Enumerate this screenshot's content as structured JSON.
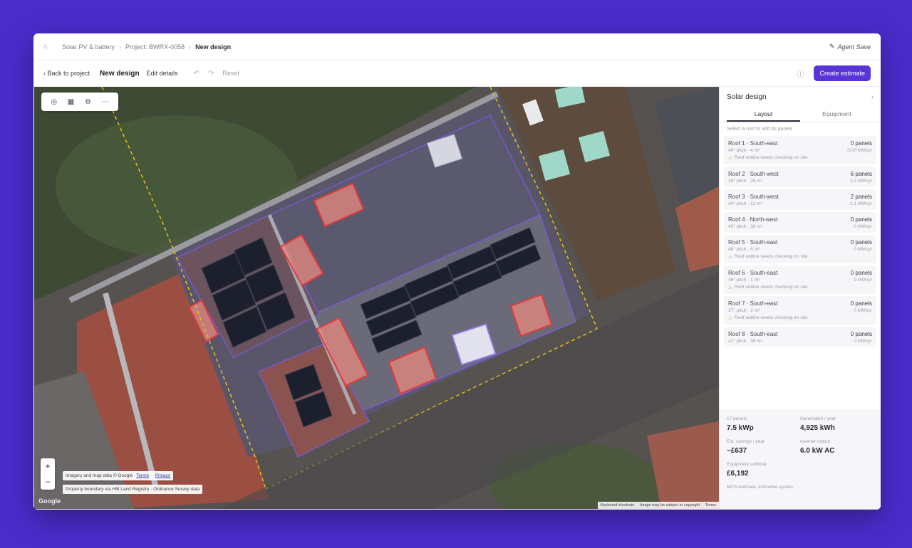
{
  "breadcrumb": {
    "items": [
      "Solar PV & battery",
      "Project: BWRX-0058"
    ],
    "current": "New design",
    "agent_save": "Agent Save"
  },
  "toolbar": {
    "back_label": "Back to project",
    "design_title": "New design",
    "edit_details": "Edit details",
    "reset": "Reset",
    "create_estimate": "Create estimate"
  },
  "map": {
    "attribution": "Imagery and map data © Google",
    "terms": "Terms",
    "privacy": "Privacy",
    "boundary_note": "Property boundary via HM Land Registry · Ordnance Survey data",
    "google": "Google",
    "footer": [
      "Keyboard shortcuts",
      "Image may be subject to copyright",
      "Terms"
    ]
  },
  "panel": {
    "title": "Solar design",
    "tabs": [
      "Layout",
      "Equipment"
    ],
    "hint": "Select a roof to add its panels",
    "roofs": [
      {
        "name": "Roof 1 · South-east",
        "panels": "0 panels",
        "meta": "40° pitch · 4 m²",
        "extra": "0.00 kWh/yr",
        "warn": "Roof outline needs checking on site"
      },
      {
        "name": "Roof 2 · South-west",
        "panels": "6 panels",
        "meta": "39° pitch · 26 m²",
        "extra": "3.2 kWh/yr",
        "warn": ""
      },
      {
        "name": "Roof 3 · South-west",
        "panels": "2 panels",
        "meta": "44° pitch · 13 m²",
        "extra": "1.1 kWh/yr",
        "warn": ""
      },
      {
        "name": "Roof 4 · North-west",
        "panels": "0 panels",
        "meta": "43° pitch · 38 m²",
        "extra": "0 kWh/yr",
        "warn": ""
      },
      {
        "name": "Roof 5 · South-east",
        "panels": "0 panels",
        "meta": "48° pitch · 6 m²",
        "extra": "0 kWh/yr",
        "warn": "Roof outline needs checking on site"
      },
      {
        "name": "Roof 6 · South-east",
        "panels": "0 panels",
        "meta": "46° pitch · 1 m²",
        "extra": "0 kWh/yr",
        "warn": "Roof outline needs checking on site"
      },
      {
        "name": "Roof 7 · South-east",
        "panels": "0 panels",
        "meta": "37° pitch · 2 m²",
        "extra": "0 kWh/yr",
        "warn": "Roof outline needs checking on site"
      },
      {
        "name": "Roof 8 · South-east",
        "panels": "0 panels",
        "meta": "42° pitch · 38 m²",
        "extra": "0 kWh/yr",
        "warn": ""
      }
    ],
    "summary": {
      "panels_label": "17 panels",
      "panels_value": "7.5 kWp",
      "generation_label": "Generation / year",
      "generation_value": "4,925 kWh",
      "savings_label": "Est. savings / year",
      "savings_value": "~£637",
      "inverter_label": "Inverter output",
      "inverter_value": "6.0 kW AC",
      "equipment_label": "Equipment subtotal",
      "equipment_value": "£6,192",
      "footnote": "MCS estimate, indicative quotes"
    }
  },
  "colors": {
    "brand_bg": "#4a2ccb",
    "accent": "#5b34d9",
    "obstruction": "#e05555",
    "roof_outline": "#6b4fe0",
    "boundary": "#e3c01b"
  },
  "icons": [
    "home-icon",
    "pin-icon",
    "undo-icon",
    "redo-icon",
    "info-icon",
    "chevron-icon",
    "warning-icon",
    "draw-tool-icon",
    "panel-tool-icon",
    "settings-tool-icon",
    "more-icon"
  ]
}
